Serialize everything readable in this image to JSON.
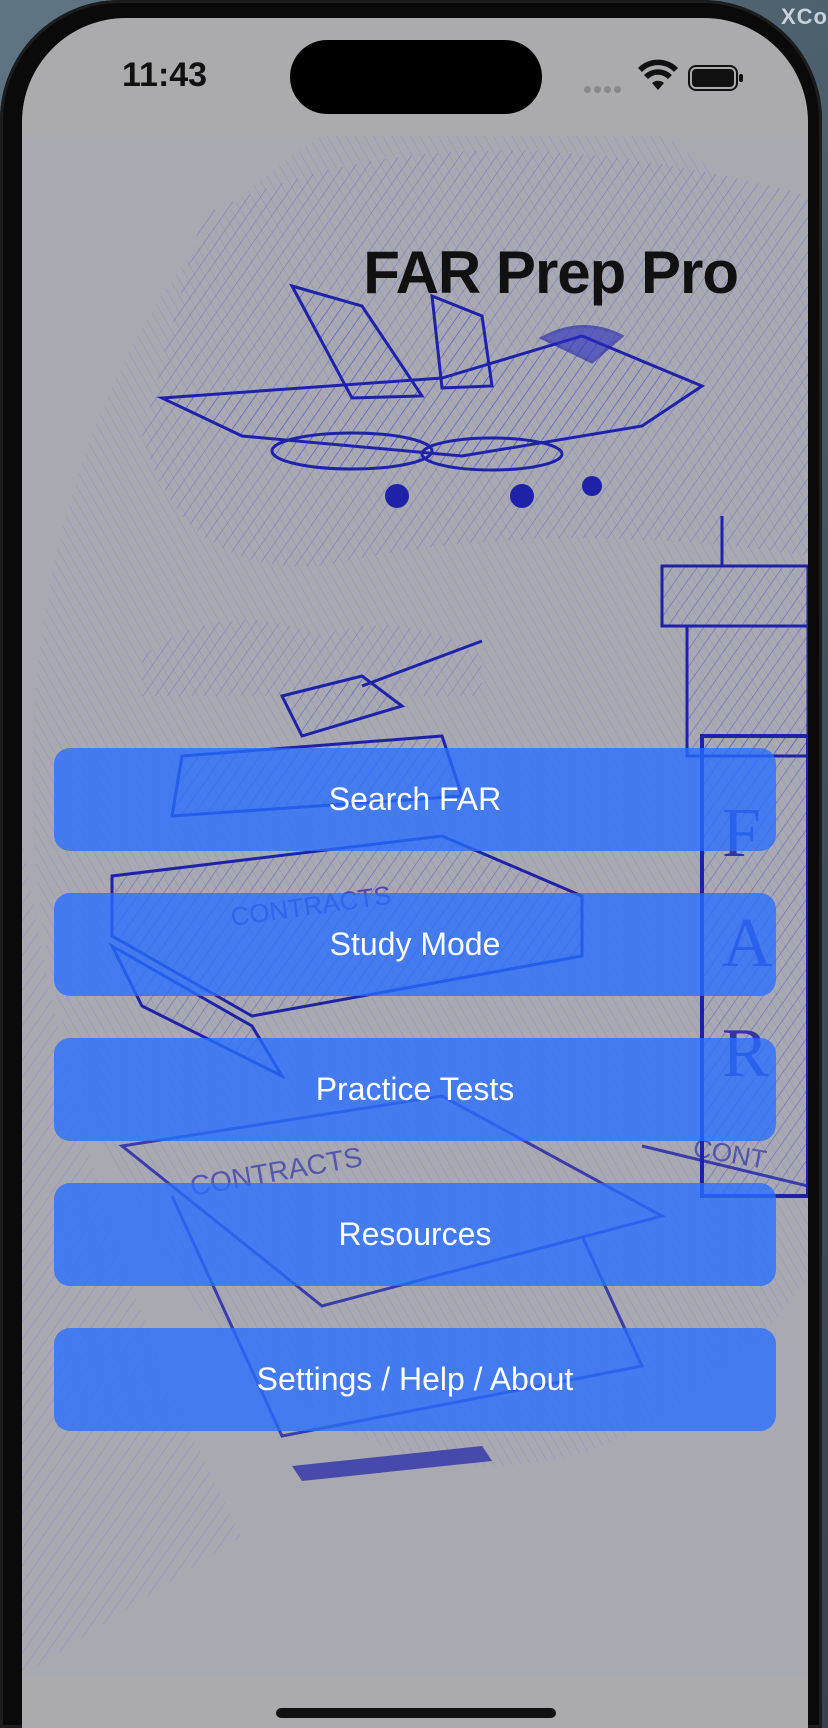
{
  "desktop": {
    "corner_label": "XCo"
  },
  "status_bar": {
    "time": "11:43",
    "icons": [
      "signal-dots-icon",
      "wifi-icon",
      "battery-icon"
    ]
  },
  "app": {
    "title": "FAR Prep Pro",
    "background_image": "pencil-sketch-of-fighter-jet-aircraft-carrier-tank-and-contract-documents",
    "menu": [
      {
        "label": "Search FAR"
      },
      {
        "label": "Study Mode"
      },
      {
        "label": "Practice Tests"
      },
      {
        "label": "Resources"
      },
      {
        "label": "Settings / Help / About"
      }
    ]
  },
  "colors": {
    "button_blue": "#2f6ef5",
    "sketch_ink": "#2a2fc0",
    "screen_gray": "#ababae"
  }
}
